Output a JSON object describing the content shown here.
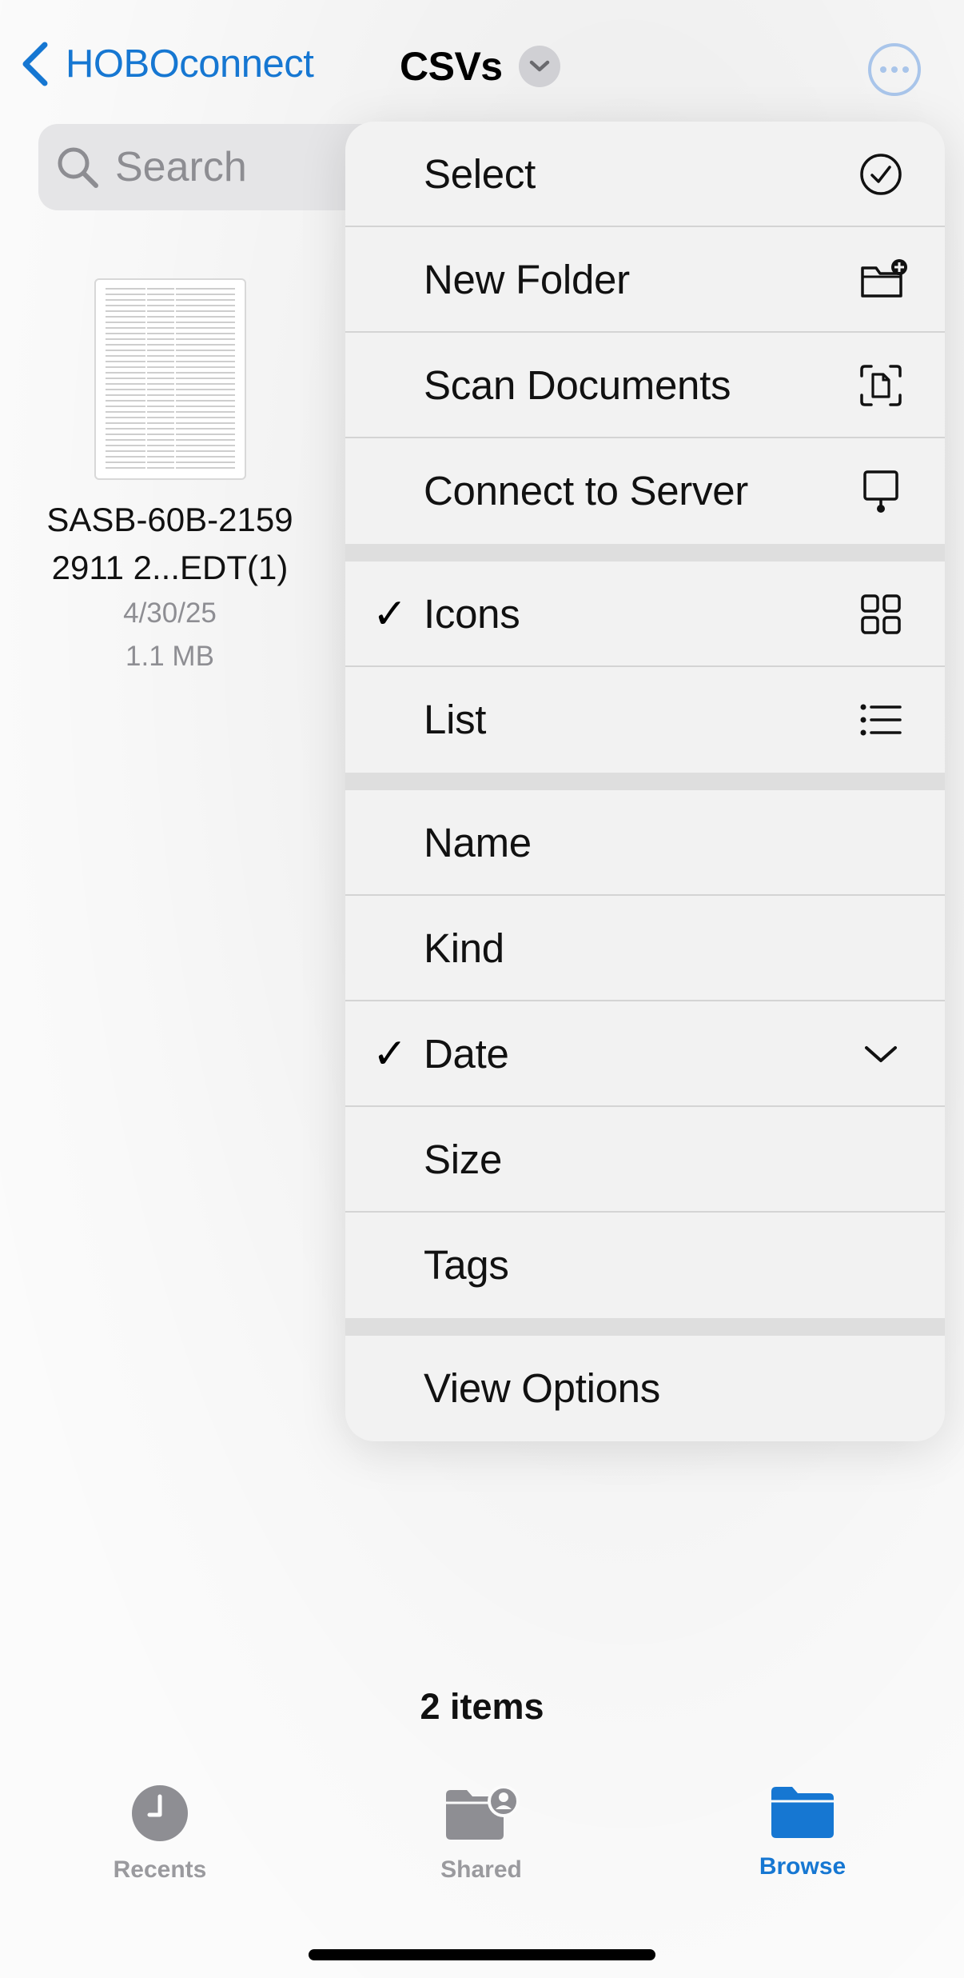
{
  "nav": {
    "back_label": "HOBOconnect",
    "title": "CSVs"
  },
  "search": {
    "placeholder": "Search"
  },
  "file": {
    "name_line1": "SASB-60B-2159",
    "name_line2": "2911 2...EDT(1)",
    "date": "4/30/25",
    "size": "1.1 MB"
  },
  "menu": {
    "actions": [
      {
        "label": "Select",
        "icon": "checkmark-circle-icon"
      },
      {
        "label": "New Folder",
        "icon": "folder-plus-icon"
      },
      {
        "label": "Scan Documents",
        "icon": "doc-scan-icon"
      },
      {
        "label": "Connect to Server",
        "icon": "server-display-icon"
      }
    ],
    "view": [
      {
        "label": "Icons",
        "checked": true,
        "icon": "grid-icon"
      },
      {
        "label": "List",
        "checked": false,
        "icon": "list-icon"
      }
    ],
    "sort": [
      {
        "label": "Name",
        "checked": false
      },
      {
        "label": "Kind",
        "checked": false
      },
      {
        "label": "Date",
        "checked": true,
        "icon": "chevron-down-icon"
      },
      {
        "label": "Size",
        "checked": false
      },
      {
        "label": "Tags",
        "checked": false
      }
    ],
    "options": {
      "label": "View Options"
    },
    "checkmark": "✓"
  },
  "footer": {
    "item_count": "2 items"
  },
  "tabs": [
    {
      "label": "Recents",
      "icon": "clock-icon",
      "active": false
    },
    {
      "label": "Shared",
      "icon": "shared-folder-icon",
      "active": false
    },
    {
      "label": "Browse",
      "icon": "folder-icon",
      "active": true
    }
  ],
  "colors": {
    "accent": "#1677d2",
    "menu_bg": "#f2f2f2",
    "separator": "#dedede"
  }
}
